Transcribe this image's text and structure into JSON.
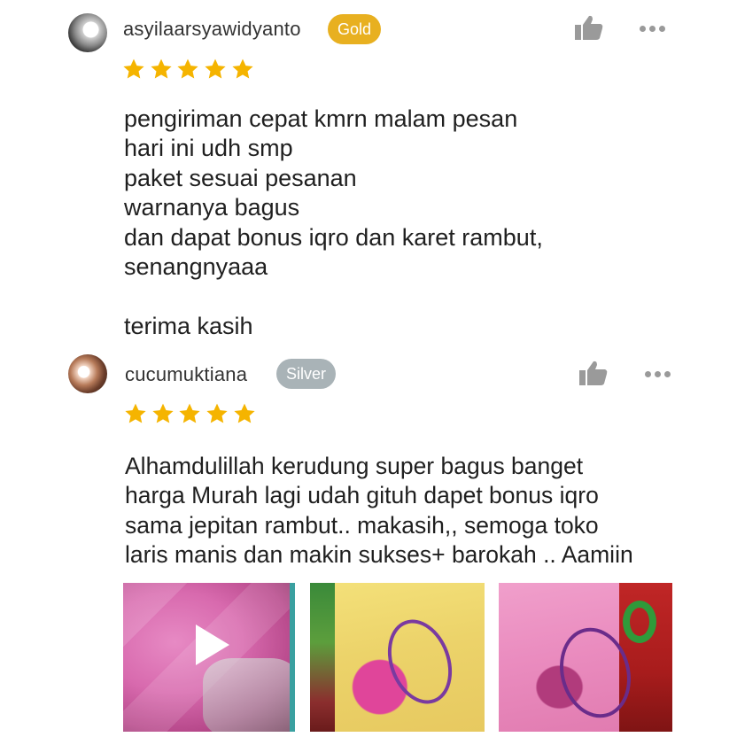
{
  "colors": {
    "gold_badge": "#e8b020",
    "silver_badge": "#a9b3b7",
    "star": "#f5b400",
    "icon_gray": "#9a9a9a"
  },
  "reviews": [
    {
      "username": "asyilaarsyawidyanto",
      "badge": "Gold",
      "rating": 5,
      "comment": "pengiriman cepat kmrn malam pesan\nhari ini udh smp\npaket sesuai pesanan\nwarnanya bagus\ndan dapat bonus iqro dan karet rambut,\nsenangnyaaa\n\nterima kasih",
      "like_icon": "thumbs-up-icon",
      "more_icon": "more-dots-icon"
    },
    {
      "username": "cucumuktiana",
      "badge": "Silver",
      "rating": 5,
      "comment": "Alhamdulillah kerudung super bagus banget\nharga Murah lagi udah gituh dapet bonus iqro\nsama jepitan rambut.. makasih,, semoga toko\nlaris manis dan makin sukses+ barokah .. Aamiin",
      "like_icon": "thumbs-up-icon",
      "more_icon": "more-dots-icon",
      "media": [
        {
          "type": "video",
          "icon": "play-icon"
        },
        {
          "type": "photo"
        },
        {
          "type": "photo"
        }
      ]
    }
  ]
}
